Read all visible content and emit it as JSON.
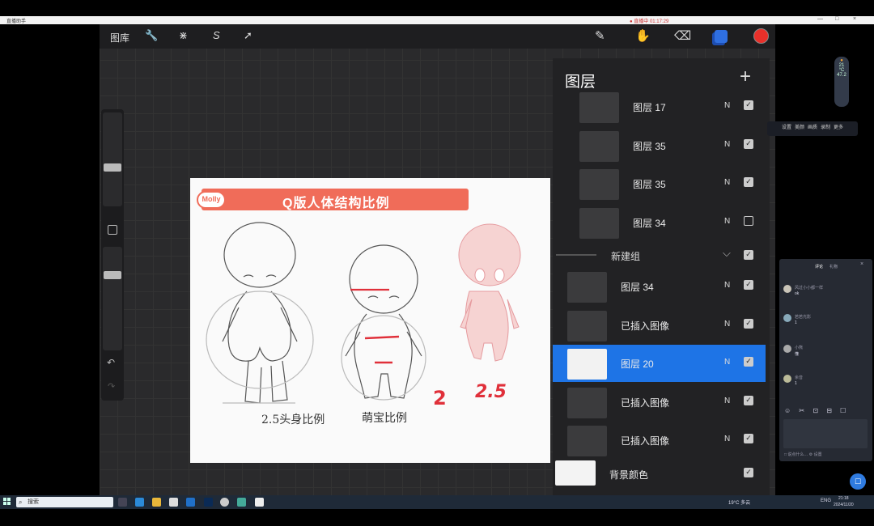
{
  "host_window": {
    "title": "直播助手",
    "center_text": "● 直播中 01:17:29",
    "controls": [
      "—",
      "□",
      "×"
    ]
  },
  "toolbar": {
    "gallery_label": "图库",
    "left_tools": [
      {
        "icon": "wrench-icon",
        "glyph": "🔧"
      },
      {
        "icon": "magic-wand-icon",
        "glyph": "⋇"
      },
      {
        "icon": "selection-s-icon",
        "glyph": "S"
      },
      {
        "icon": "transform-arrow-icon",
        "glyph": "➚"
      }
    ],
    "right_tools": [
      {
        "icon": "brush-icon",
        "glyph": "✎"
      },
      {
        "icon": "smudge-icon",
        "glyph": "✋"
      },
      {
        "icon": "eraser-icon",
        "glyph": "⌫"
      }
    ],
    "layers_icon": "layers-icon",
    "current_color": "#e8302a"
  },
  "sidebar": {
    "undo_glyph": "↶",
    "redo_glyph": "↷"
  },
  "canvas": {
    "banner_title": "Q版人体结构比例",
    "logo_text": "Molly",
    "label_left": "2.5头身比例",
    "label_middle": "萌宝比例",
    "num_2": "2",
    "num_25": "2.5",
    "accent_color": "#f06c59"
  },
  "layers_panel": {
    "title": "图层",
    "add_glyph": "+",
    "layers": [
      {
        "name": "图层 17",
        "blend": "N",
        "visible": true,
        "selected": false
      },
      {
        "name": "图层 35",
        "blend": "N",
        "visible": true,
        "selected": false
      },
      {
        "name": "图层 35",
        "blend": "N",
        "visible": true,
        "selected": false
      },
      {
        "name": "图层 34",
        "blend": "N",
        "visible": false,
        "selected": false
      }
    ],
    "group": {
      "name": "新建组",
      "chevron": "⌵",
      "visible": true
    },
    "group_layers": [
      {
        "name": "图层 34",
        "blend": "N",
        "visible": true,
        "selected": false
      },
      {
        "name": "已插入图像",
        "blend": "N",
        "visible": true,
        "selected": false
      },
      {
        "name": "图层 20",
        "blend": "N",
        "visible": true,
        "selected": true
      },
      {
        "name": "已插入图像",
        "blend": "N",
        "visible": true,
        "selected": false
      },
      {
        "name": "已插入图像",
        "blend": "N",
        "visible": true,
        "selected": false
      }
    ],
    "background": {
      "name": "背景颜色",
      "visible": true
    },
    "check_glyph": "✓"
  },
  "stream": {
    "widget_text": [
      "21",
      "°C",
      "47.2"
    ],
    "toolrow_items": [
      "设置",
      "美颜",
      "画质",
      "录制",
      "更多"
    ],
    "chat_tabs": [
      "评论",
      "礼物"
    ],
    "chat_close": "×",
    "messages": [
      {
        "name": "风过小小都一样",
        "text": "ok"
      },
      {
        "name": "若若光影",
        "text": "1"
      },
      {
        "name": "小熊",
        "text": "懂"
      },
      {
        "name": "余音",
        "text": "1"
      }
    ],
    "chat_icons": "☺ ✂ ⊡ ⊟ ☐",
    "chat_footer": "□ 说点什么…  ⚙ 设置",
    "fab_glyph": "☐"
  },
  "taskbar": {
    "search_placeholder": "搜索",
    "weather": "19°C 多云",
    "lang": "ENG",
    "time": "21:18",
    "date": "2024/11/20"
  }
}
